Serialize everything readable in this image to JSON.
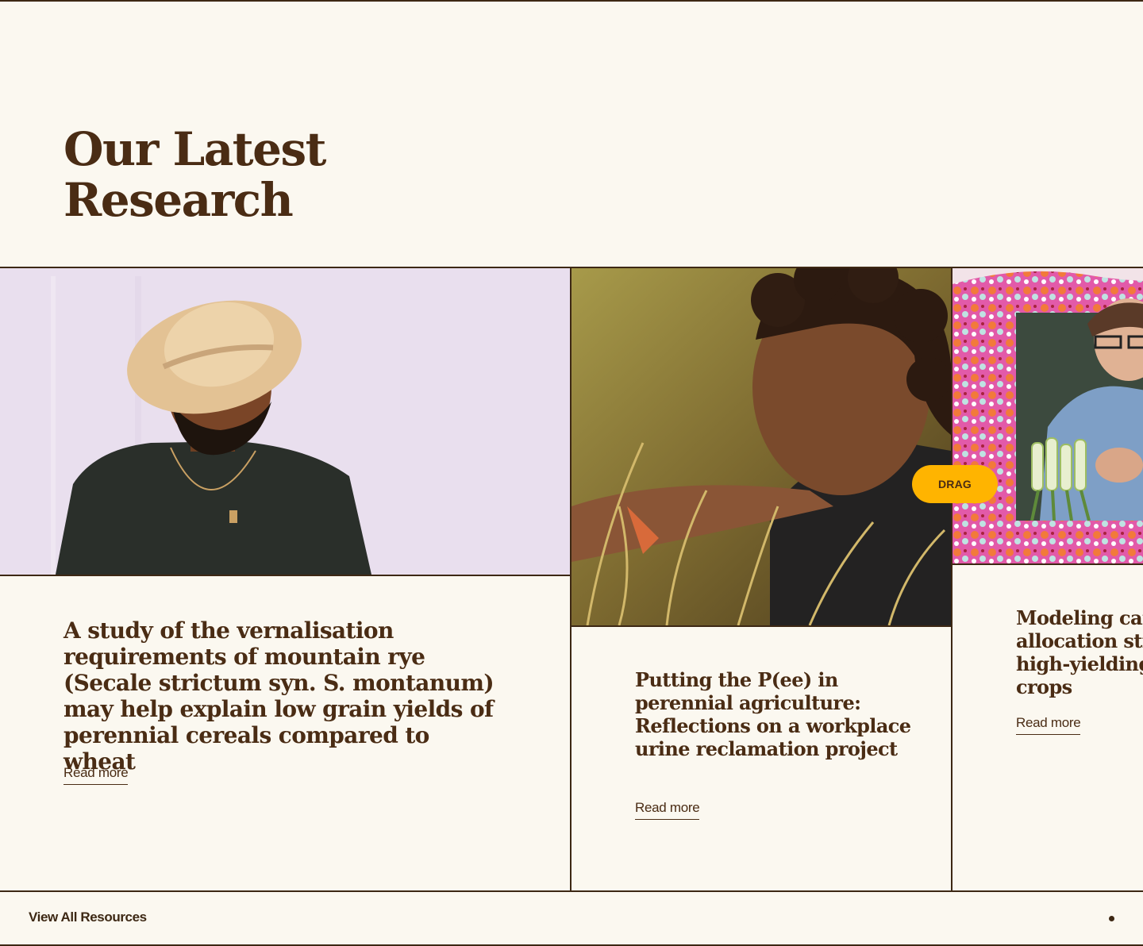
{
  "section": {
    "title": "Our Latest Research"
  },
  "cards": [
    {
      "title": "A study of the vernalisation requirements of mountain rye (Secale strictum syn. S. montanum) may help explain low grain yields of perennial cereals compared to wheat",
      "read_more": "Read more",
      "image": "man-in-hat-portrait"
    },
    {
      "title": "Putting the P(ee) in perennial agriculture: Reflections on a workplace urine reclamation project",
      "read_more": "Read more",
      "image": "person-harvesting-grain"
    },
    {
      "title_lines": [
        "Modeling carbon",
        "allocation strategies in",
        "high-yielding",
        "crops"
      ],
      "read_more": "Read more",
      "image": "woman-holding-leeks-patterned-frame"
    }
  ],
  "drag_badge": "DRAG",
  "footer": {
    "view_all": "View All Resources"
  },
  "colors": {
    "background": "#fbf8f0",
    "text": "#4a2c14",
    "rule": "#3d2814",
    "accent": "#ffb400",
    "lavender": "#e9dfee"
  }
}
